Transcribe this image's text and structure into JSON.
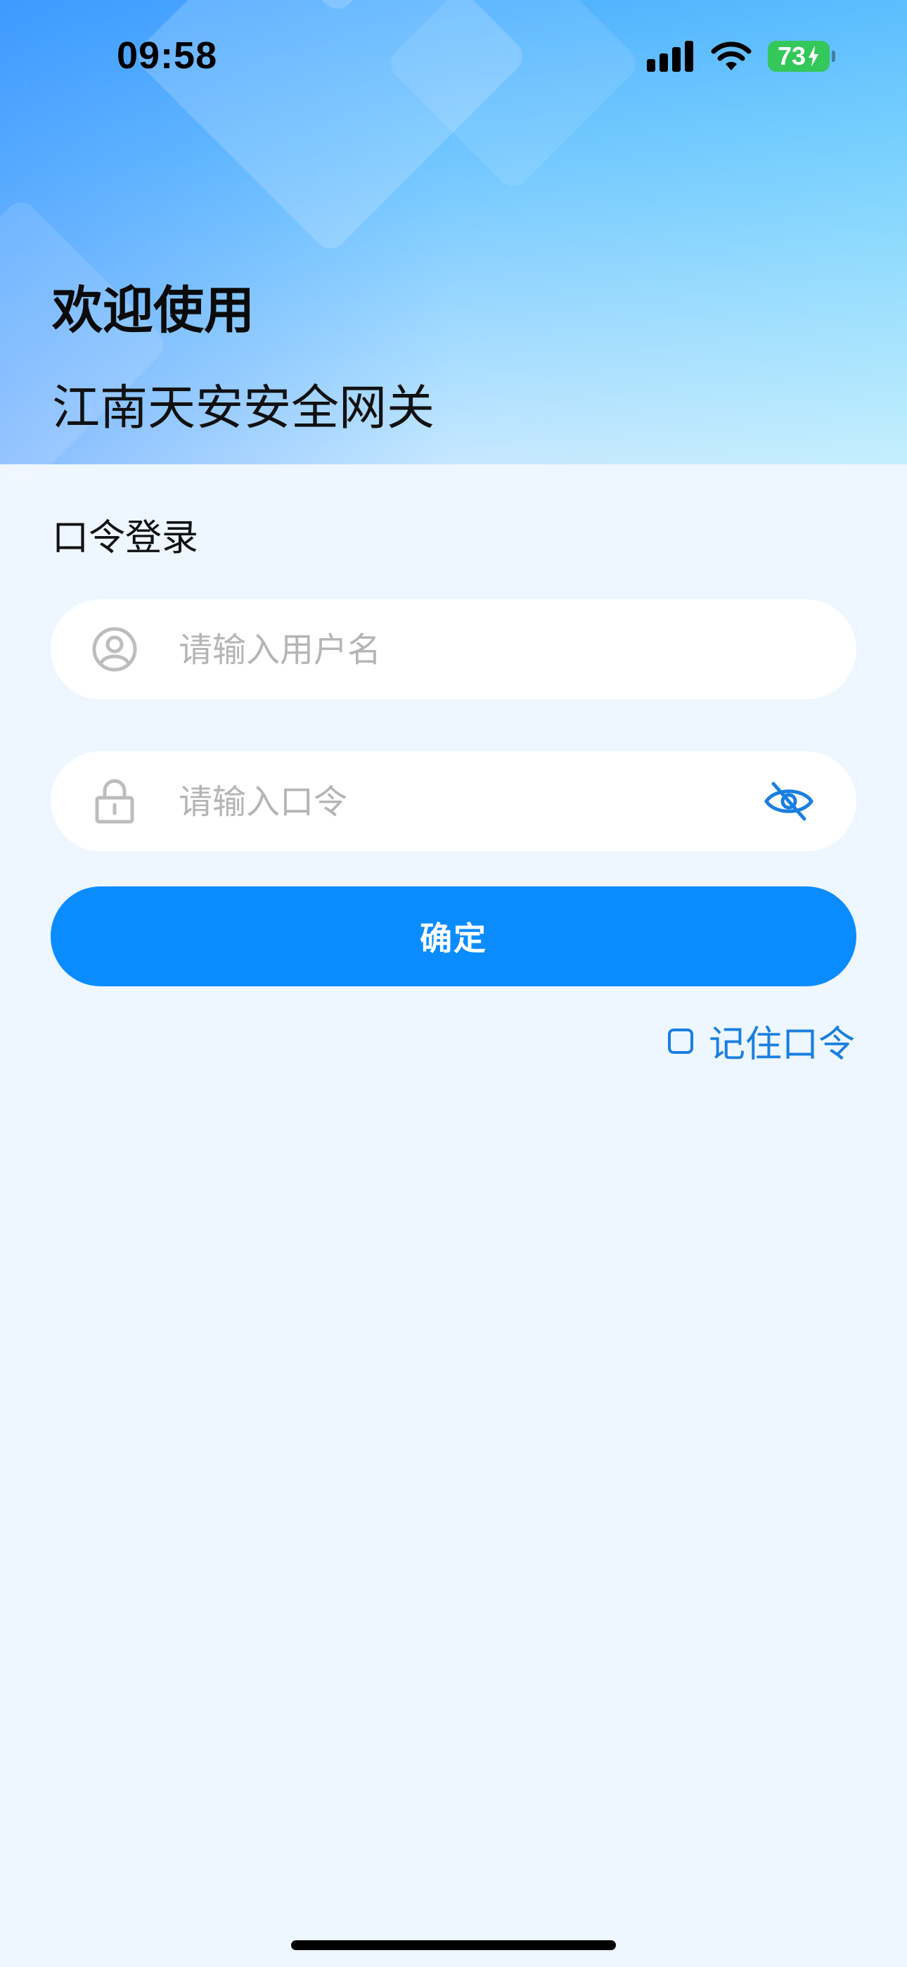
{
  "status_bar": {
    "time": "09:58",
    "battery": "73",
    "icons": [
      "cellular-signal-icon",
      "wifi-icon",
      "battery-charging-icon"
    ]
  },
  "header": {
    "welcome": "欢迎使用",
    "app_name": "江南天安安全网关"
  },
  "login": {
    "section_title": "口令登录",
    "username": {
      "placeholder": "请输入用户名",
      "value": "",
      "icon": "user-icon"
    },
    "password": {
      "placeholder": "请输入口令",
      "value": "",
      "icon": "lock-icon",
      "toggle_icon": "eye-off-icon"
    },
    "confirm_label": "确定",
    "remember_label": "记住口令",
    "remember_checked": false
  },
  "colors": {
    "primary": "#0a8cff",
    "link": "#1a7fe0",
    "background": "#eef6ff",
    "battery": "#34c759",
    "placeholder": "#b5b5b5"
  }
}
